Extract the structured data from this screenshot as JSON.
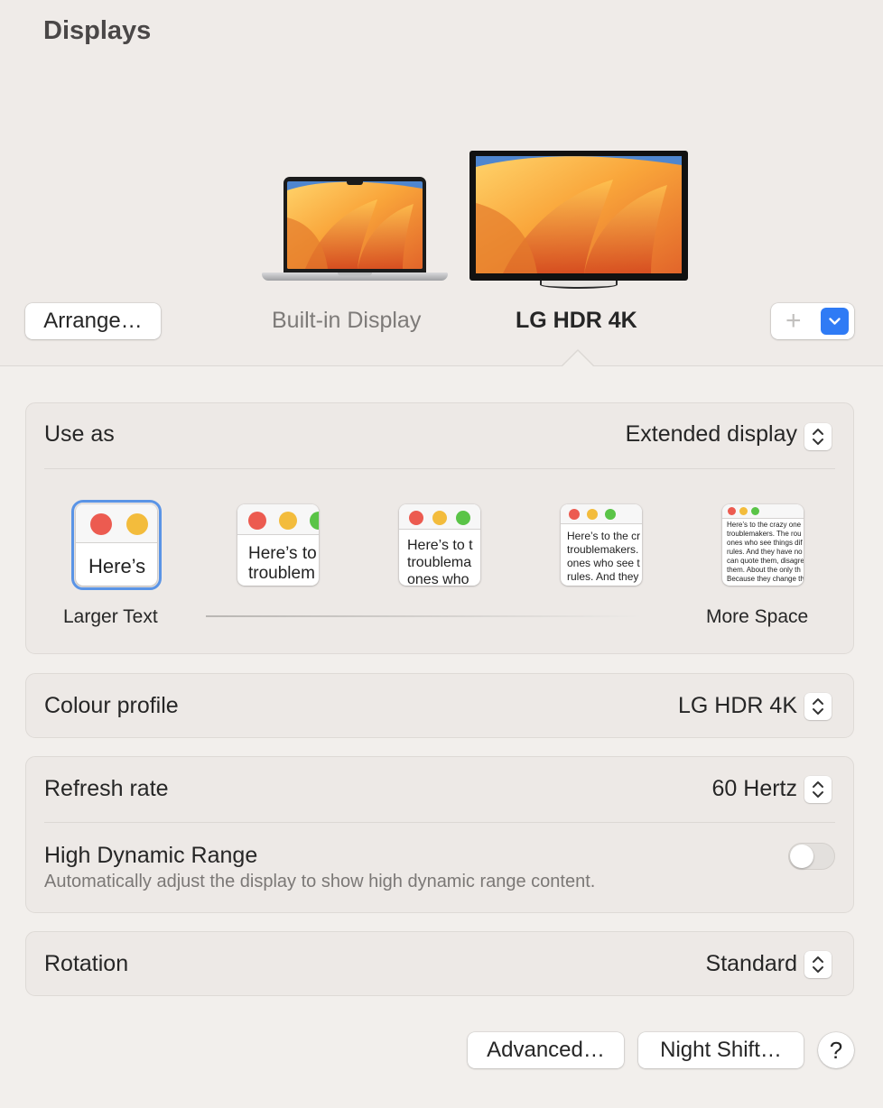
{
  "window": {
    "title": "Displays"
  },
  "displays": [
    {
      "name": "Built-in Display",
      "selected": false
    },
    {
      "name": "LG HDR 4K",
      "selected": true
    }
  ],
  "toolbar": {
    "arrange_label": "Arrange…",
    "add_icon": "plus-icon",
    "menu_icon": "chevron-down-icon"
  },
  "use_as": {
    "label": "Use as",
    "value": "Extended display"
  },
  "resolution": {
    "left_label": "Larger Text",
    "right_label": "More Space",
    "selected_index": 0,
    "options": [
      {
        "text": "Here’s"
      },
      {
        "text": "Here’s to\ntroublem"
      },
      {
        "text": "Here’s to t\ntroublema\nones who"
      },
      {
        "text": "Here’s to the cr\ntroublemakers.\nones who see t\nrules. And they"
      },
      {
        "text": "Here’s to the crazy one\ntroublemakers. The rou\nones who see things dif\nrules. And they have no\ncan quote them, disagre\nthem. About the only th\nBecause they change th"
      }
    ]
  },
  "colour_profile": {
    "label": "Colour profile",
    "value": "LG HDR 4K"
  },
  "refresh_rate": {
    "label": "Refresh rate",
    "value": "60 Hertz"
  },
  "hdr": {
    "label": "High Dynamic Range",
    "description": "Automatically adjust the display to show high dynamic range content.",
    "enabled": false
  },
  "rotation": {
    "label": "Rotation",
    "value": "Standard"
  },
  "footer": {
    "advanced_label": "Advanced…",
    "night_shift_label": "Night Shift…",
    "help_label": "?"
  },
  "colors": {
    "accent": "#2f7bf5",
    "selection": "#5a94e6",
    "background": "#f2efec"
  }
}
